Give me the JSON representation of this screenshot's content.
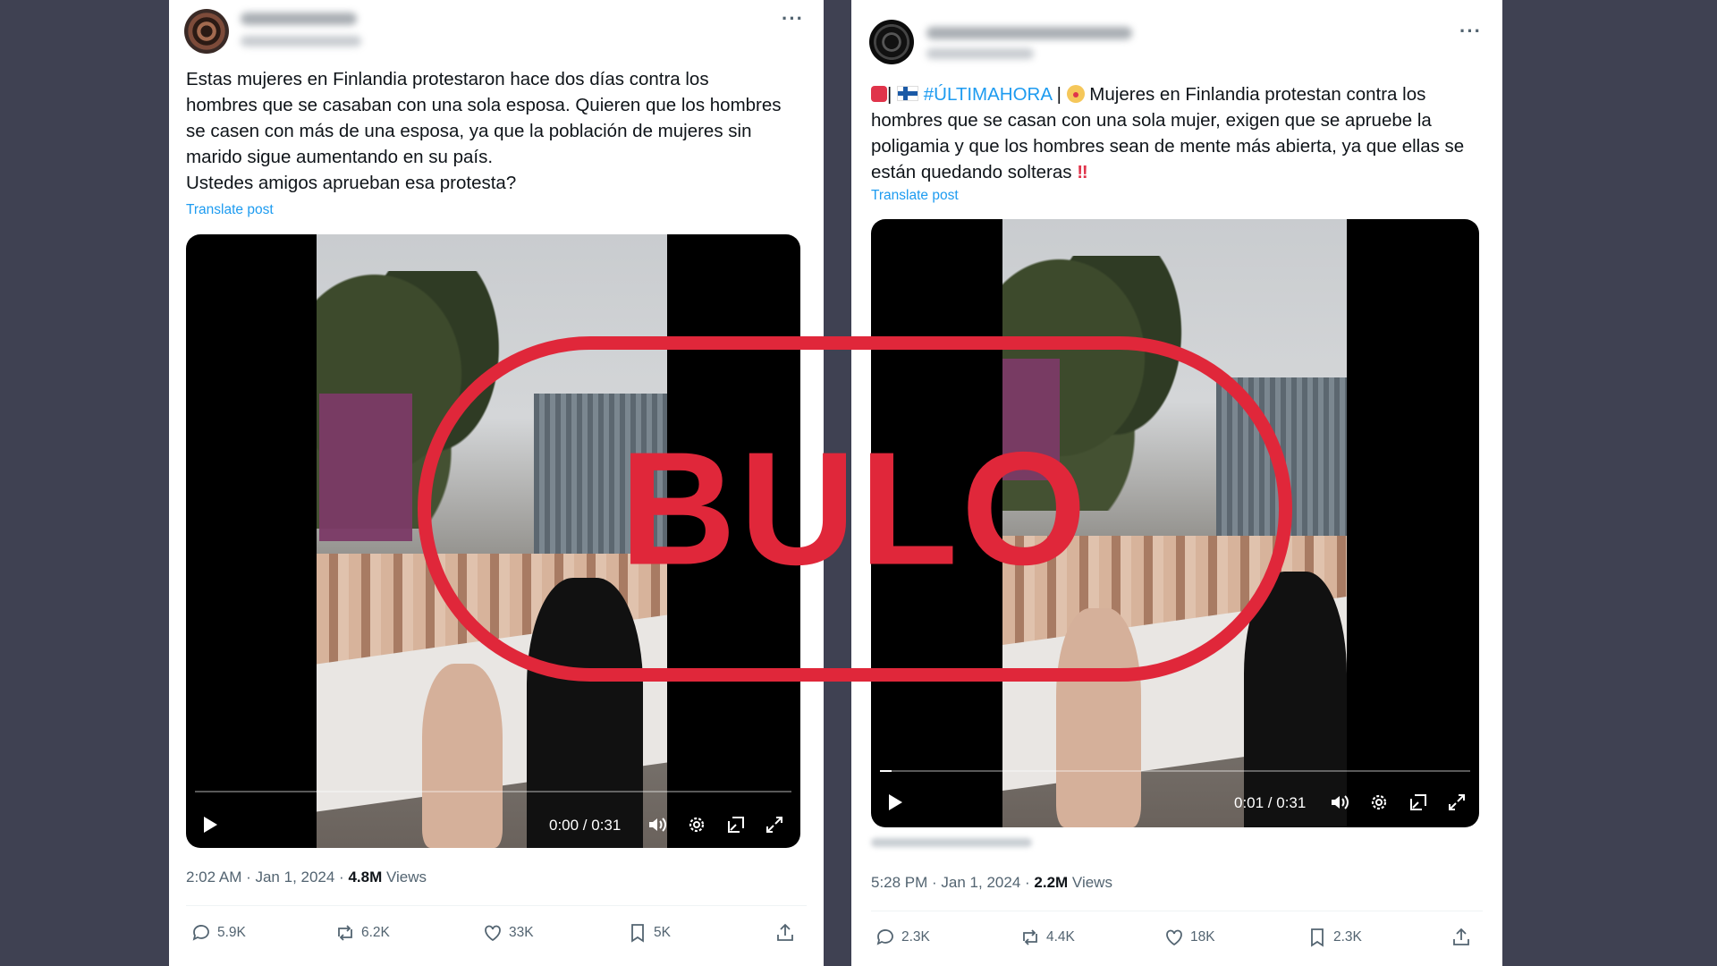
{
  "left_post": {
    "text": "Estas mujeres en Finlandia protestaron hace dos días contra los\nhombres que se casaban con una sola esposa. Quieren que los hombres\nse casen con más de una esposa, ya que la población de mujeres sin\nmarido sigue aumentando en su país.\nUstedes amigos aprueban esa protesta?",
    "translate_label": "Translate post",
    "more_label": "···",
    "video": {
      "time": "0:00 / 0:31",
      "progress": 0.0
    },
    "timestamp": "2:02 AM · Jan 1, 2024 · ",
    "views_count": "4.8M",
    "views_label": " Views",
    "actions": {
      "replies": "5.9K",
      "reposts": "6.2K",
      "likes": "33K",
      "bookmarks": "5K"
    }
  },
  "right_post": {
    "text_part1": "| ",
    "hashtag": "#ÚLTIMAHORA",
    "text_part2": " | ",
    "text_main": " Mujeres en Finlandia protestan contra los\nhombres que se casan con una sola mujer, exigen que se apruebe la\npoligamia y que los hombres sean de mente más abierta, ya que ellas se\nestán quedando solteras",
    "bangbang": "‼",
    "translate_label": "Translate post",
    "more_label": "···",
    "video": {
      "time": "0:01 / 0:31",
      "progress": 0.02
    },
    "timestamp": "5:28 PM · Jan 1, 2024 · ",
    "views_count": "2.2M",
    "views_label": " Views",
    "actions": {
      "replies": "2.3K",
      "reposts": "4.4K",
      "likes": "18K",
      "bookmarks": "2.3K"
    }
  },
  "stamp": {
    "label": "BULO",
    "color": "#e0273a"
  },
  "colors": {
    "link": "#1d9bf0",
    "muted": "#536471",
    "text": "#0f1419",
    "background": "#3f4152"
  }
}
